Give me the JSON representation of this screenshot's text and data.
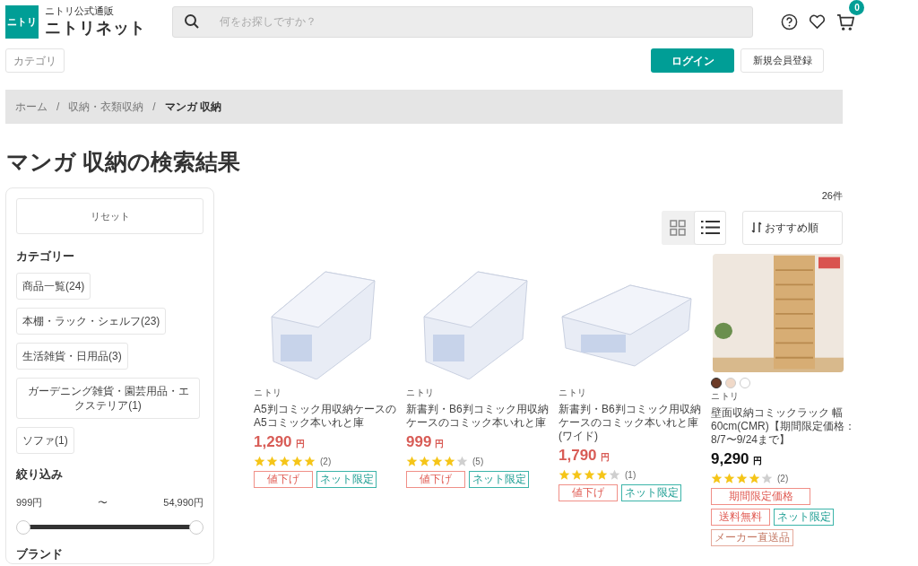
{
  "header": {
    "logo_mark": "ニトリ",
    "logo_subtitle": "ニトリ公式通販",
    "logo_title": "ニトリネット",
    "search": {
      "placeholder": "何をお探しですか？"
    },
    "cart_count": "0"
  },
  "nav": {
    "category_button": "カテゴリ",
    "login_button": "ログイン",
    "register_button": "新規会員登録"
  },
  "breadcrumb": [
    {
      "label": "ホーム",
      "current": false
    },
    {
      "separator_before": "/",
      "label": "収納・衣類収納",
      "current": false
    },
    {
      "separator_before": "/",
      "label": "マンガ 収納",
      "current": true
    }
  ],
  "page_title": "マンガ 収納の検索結果",
  "sidebar": {
    "reset_button": "リセット",
    "category_heading": "カテゴリー",
    "categories": [
      "商品一覧(24)",
      "本棚・ラック・シェルフ(23)",
      "生活雑貨・日用品(3)",
      "ガーデニング雑貨・園芸用品・エクステリア(1)",
      "ソファ(1)"
    ],
    "filter_heading": "絞り込み",
    "price_min": "999円",
    "price_sep": "〜",
    "price_max": "54,990円",
    "price_slider": {
      "level": 1
    },
    "brand_heading": "ブランド"
  },
  "results": {
    "count": "26件",
    "view_toggle": [
      {
        "kind": "grid",
        "selected": false
      },
      {
        "kind": "list",
        "selected": true
      }
    ],
    "sort": "おすすめ順",
    "products": [
      {
        "kind": "box",
        "brand": "ニトリ",
        "name": "A5判コミック用収納ケースのA5コミック本いれと庫",
        "price": "1,290",
        "currency": "円",
        "discounted": true,
        "stars": 5,
        "reviews": "(2)",
        "tags": [
          {
            "label": "値下げ",
            "kind": "sale"
          },
          {
            "label": "ネット限定",
            "kind": "net"
          }
        ]
      },
      {
        "kind": "box",
        "brand": "ニトリ",
        "name": "新書判・B6判コミック用収納ケースのコミック本いれと庫",
        "price": "999",
        "currency": "円",
        "discounted": true,
        "stars": 4,
        "reviews": "(5)",
        "tags": [
          {
            "label": "値下げ",
            "kind": "sale"
          },
          {
            "label": "ネット限定",
            "kind": "net"
          }
        ]
      },
      {
        "kind": "wide",
        "brand": "ニトリ",
        "name": "新書判・B6判コミック用収納ケースのコミック本いれと庫(ワイド)",
        "price": "1,790",
        "currency": "円",
        "discounted": true,
        "stars": 4,
        "reviews": "(1)",
        "tags": [
          {
            "label": "値下げ",
            "kind": "sale"
          },
          {
            "label": "ネット限定",
            "kind": "net"
          }
        ]
      },
      {
        "kind": "shelf",
        "brand": "ニトリ",
        "name": "壁面収納コミックラック 幅60cm(CMR)【期間限定価格：8/7〜9/24まで】",
        "price": "9,290",
        "currency": "円",
        "discounted": false,
        "stars": 4,
        "reviews": "(2)",
        "swatches": [
          {
            "color": "#6b3a26",
            "selected": true
          },
          {
            "color": "#f0d9c8",
            "selected": false
          },
          {
            "color": "#ffffff",
            "selected": false
          }
        ],
        "tags": [
          {
            "label": "期間限定価格",
            "kind": "wide_sale"
          },
          {
            "label": "送料無料",
            "kind": "sale"
          },
          {
            "label": "ネット限定",
            "kind": "net"
          },
          {
            "label": "メーカー直送品",
            "kind": "maker"
          }
        ]
      }
    ]
  }
}
